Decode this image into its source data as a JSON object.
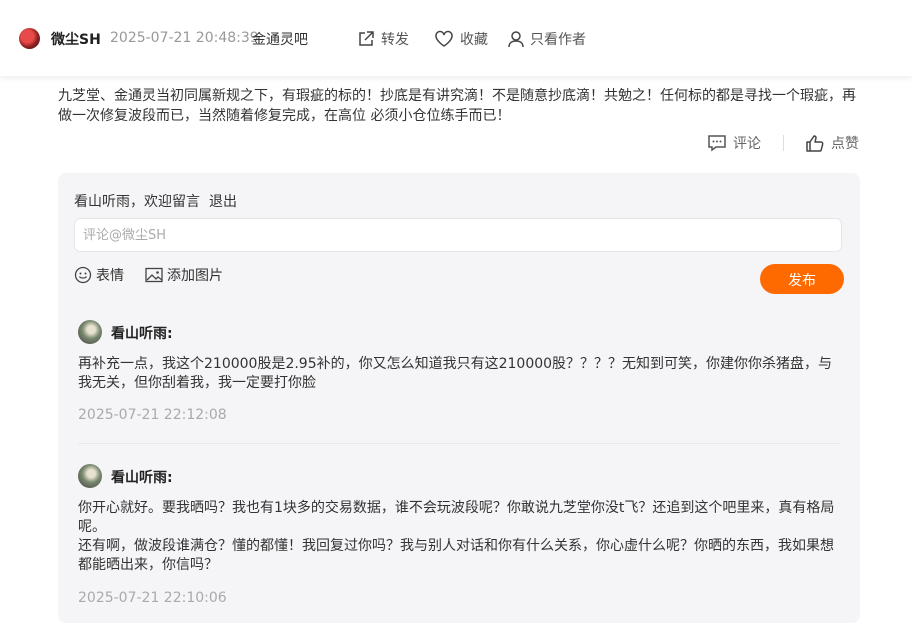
{
  "header": {
    "author": "微尘SH",
    "time": "2025-07-21 20:48:39",
    "bar": "金通灵吧",
    "share_label": "转发",
    "favorite_label": "收藏",
    "only_author_label": "只看作者"
  },
  "post": {
    "content": "九芝堂、金通灵当初同属新规之下，有瑕疵的标的！抄底是有讲究滴！不是随意抄底滴！共勉之！任何标的都是寻找一个瑕疵，再做一次修复波段而已，当然随着修复完成，在高位 必须小仓位练手而已！",
    "comment_label": "评论",
    "like_label": "点赞"
  },
  "comment_box": {
    "welcome": "看山听雨，欢迎留言",
    "logout": "退出",
    "placeholder": "评论@微尘SH",
    "emoji_label": "表情",
    "image_label": "添加图片",
    "publish_label": "发布"
  },
  "replies": [
    {
      "name": "看山听雨:",
      "text": "再补充一点，我这个210000股是2.95补的，你又怎么知道我只有这210000股？？？？无知到可笑，你建你你杀猪盘，与我无关，但你刮着我，我一定要打你脸",
      "time": "2025-07-21 22:12:08"
    },
    {
      "name": "看山听雨:",
      "text": "你开心就好。要我晒吗？我也有1块多的交易数据，谁不会玩波段呢？你敢说九芝堂你没t飞？还追到这个吧里来，真有格局呢。\n还有啊，做波段谁满仓？懂的都懂！我回复过你吗？我与别人对话和你有什么关系，你心虚什么呢？你晒的东西，我如果想都能晒出来，你信吗？",
      "time": "2025-07-21 22:10:06"
    }
  ],
  "colors": {
    "accent": "#ff6a00",
    "muted": "#999999",
    "panel": "#f5f5f7"
  }
}
